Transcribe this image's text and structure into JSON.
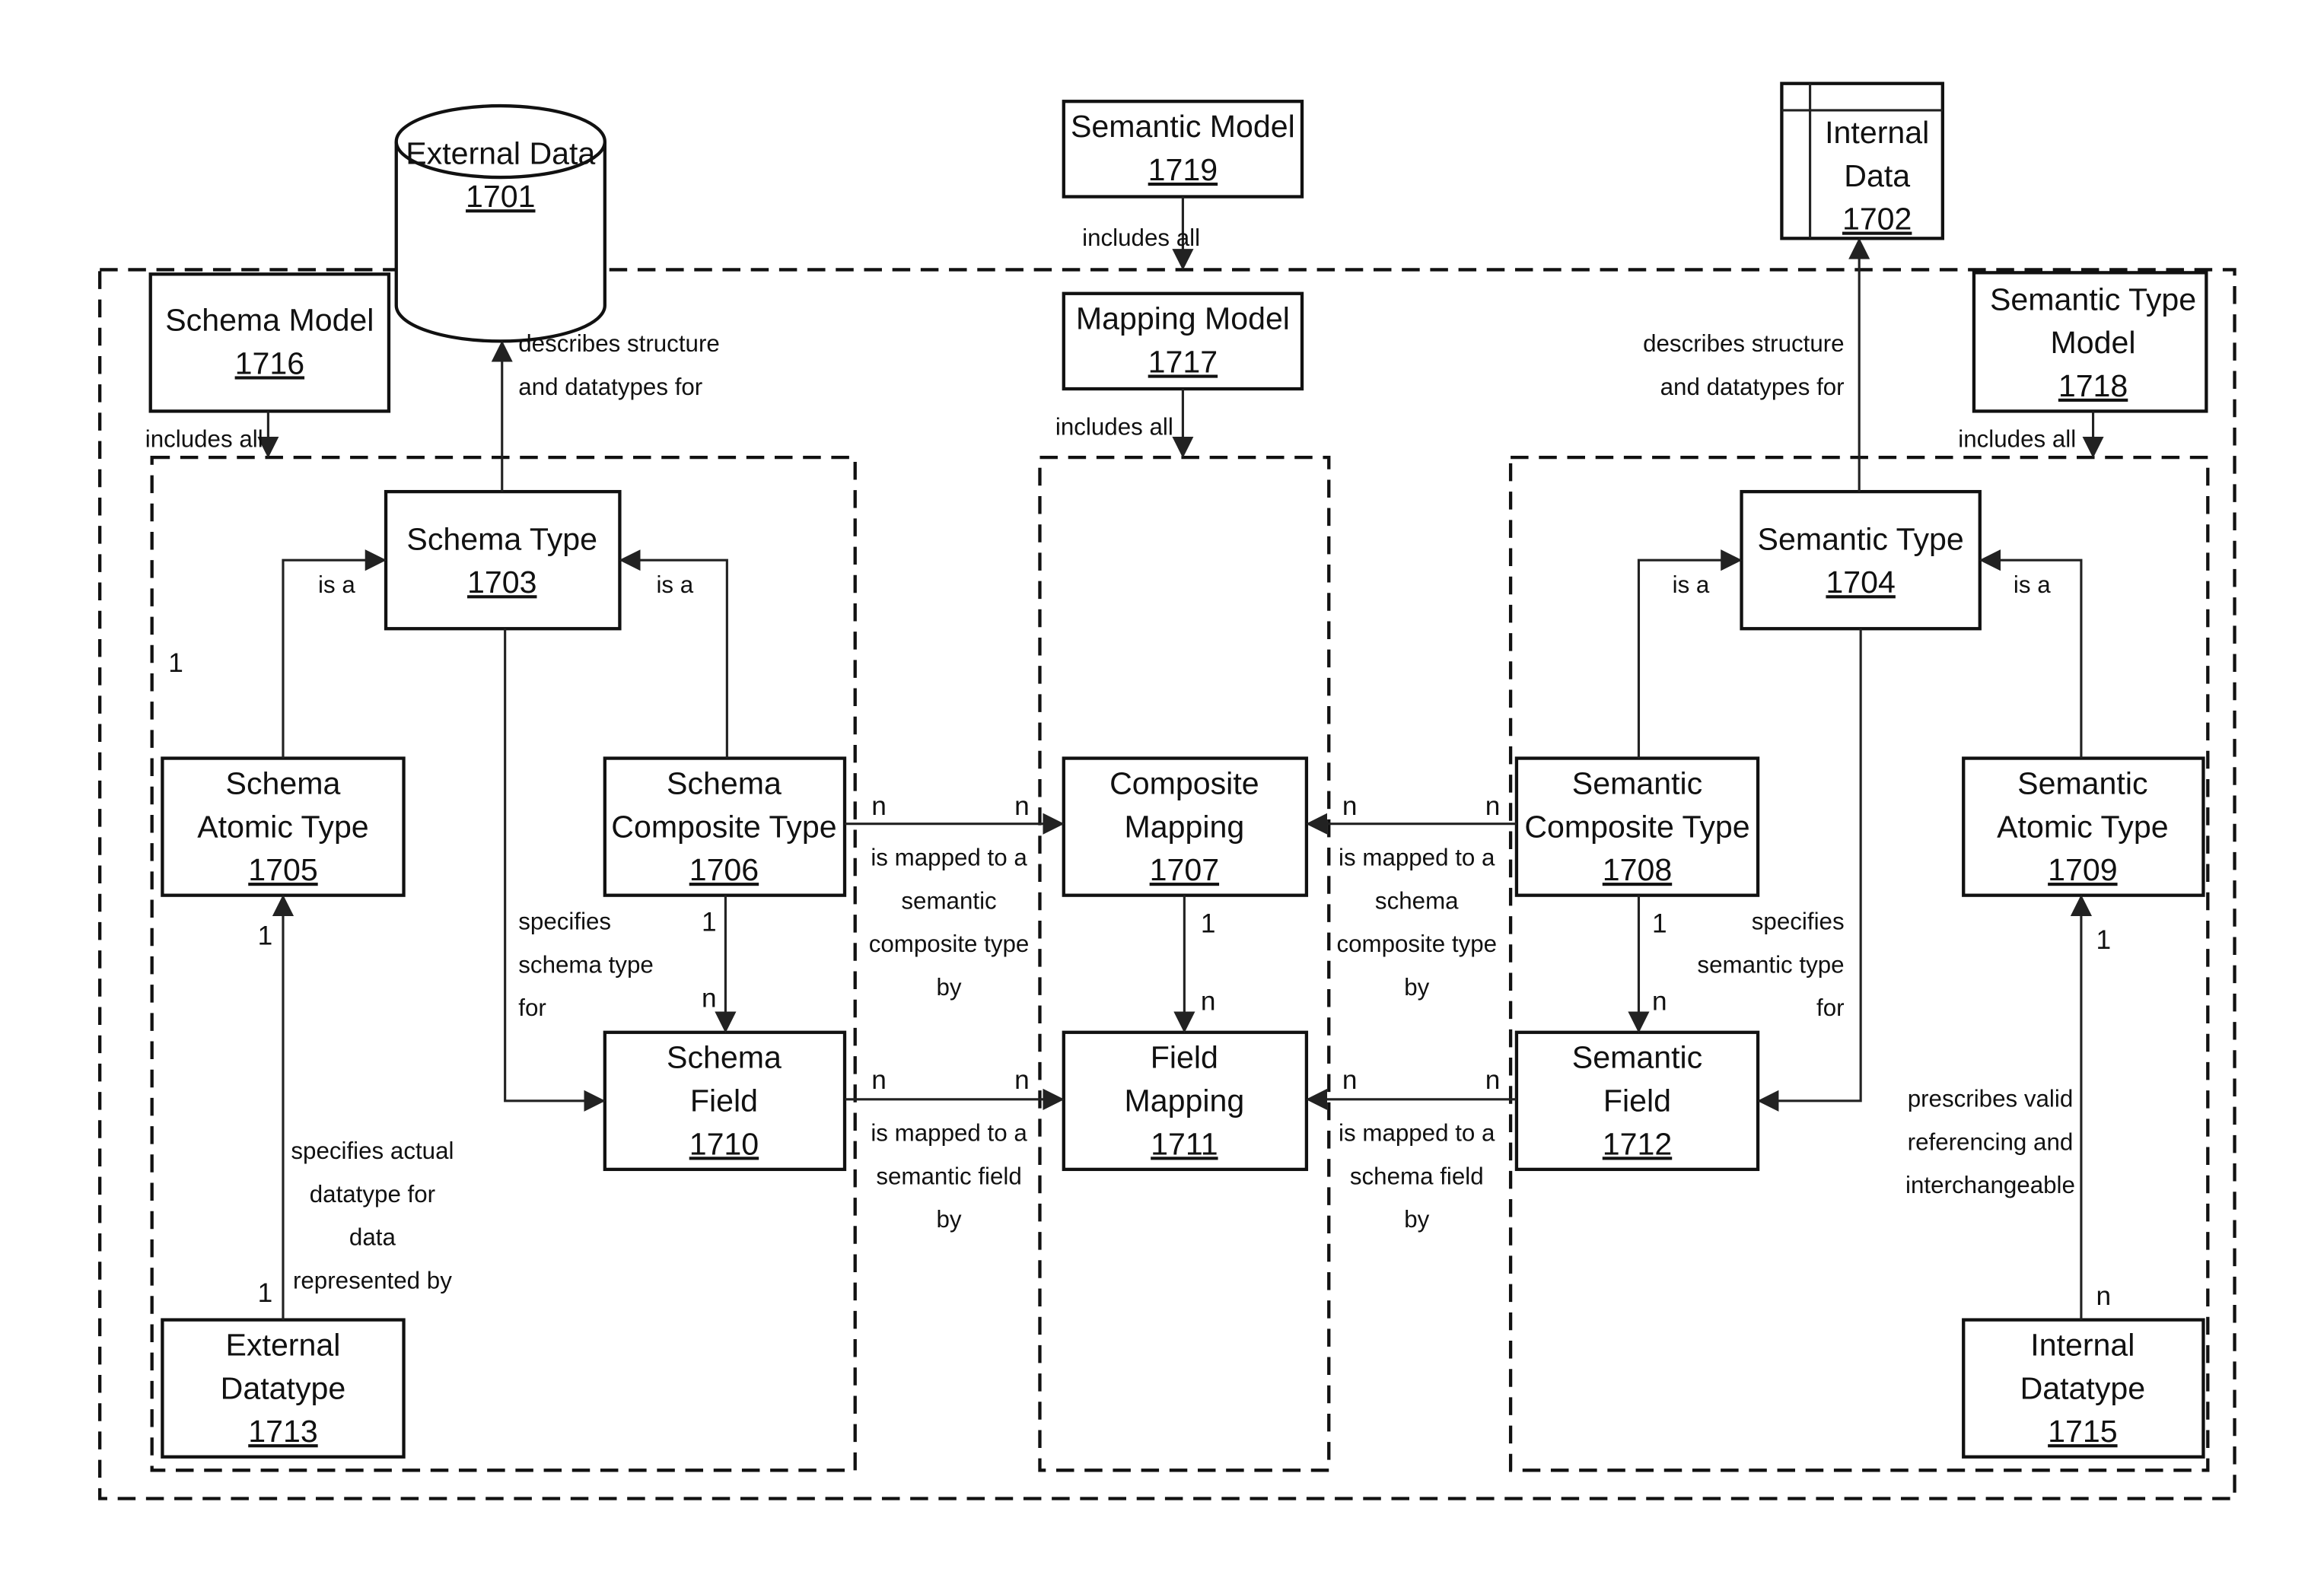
{
  "nodes": {
    "external_data": {
      "lines": [
        "External Data"
      ],
      "num": "1701"
    },
    "internal_data": {
      "lines": [
        "Internal",
        "Data"
      ],
      "num": "1702"
    },
    "schema_type": {
      "lines": [
        "Schema Type"
      ],
      "num": "1703"
    },
    "semantic_type": {
      "lines": [
        "Semantic Type"
      ],
      "num": "1704"
    },
    "schema_atomic_type": {
      "lines": [
        "Schema",
        "Atomic Type"
      ],
      "num": "1705"
    },
    "schema_composite_type": {
      "lines": [
        "Schema",
        "Composite Type"
      ],
      "num": "1706"
    },
    "composite_mapping": {
      "lines": [
        "Composite",
        "Mapping"
      ],
      "num": "1707"
    },
    "semantic_composite_type": {
      "lines": [
        "Semantic",
        "Composite Type"
      ],
      "num": "1708"
    },
    "semantic_atomic_type": {
      "lines": [
        "Semantic",
        "Atomic Type"
      ],
      "num": "1709"
    },
    "schema_field": {
      "lines": [
        "Schema",
        "Field"
      ],
      "num": "1710"
    },
    "field_mapping": {
      "lines": [
        "Field",
        "Mapping"
      ],
      "num": "1711"
    },
    "semantic_field": {
      "lines": [
        "Semantic",
        "Field"
      ],
      "num": "1712"
    },
    "external_datatype": {
      "lines": [
        "External",
        "Datatype"
      ],
      "num": "1713"
    },
    "internal_datatype": {
      "lines": [
        "Internal",
        "Datatype"
      ],
      "num": "1715"
    },
    "schema_model": {
      "lines": [
        "Schema Model"
      ],
      "num": "1716"
    },
    "mapping_model": {
      "lines": [
        "Mapping Model"
      ],
      "num": "1717"
    },
    "semantic_type_model": {
      "lines": [
        "Semantic Type",
        "Model"
      ],
      "num": "1718"
    },
    "semantic_model": {
      "lines": [
        "Semantic Model"
      ],
      "num": "1719"
    }
  },
  "labels": {
    "includes_all": "includes all",
    "is_a": "is a",
    "describes_structure": [
      "describes structure",
      "and datatypes for"
    ],
    "specifies_schema_type": [
      "specifies",
      "schema type",
      "for"
    ],
    "specifies_semantic_type": [
      "specifies",
      "semantic type",
      "for"
    ],
    "specifies_actual_datatype": [
      "specifies actual",
      "datatype for",
      "data",
      "represented by"
    ],
    "prescribes_valid": [
      "prescribes valid",
      "referencing and",
      "interchangeable"
    ],
    "mapped_semantic_composite": [
      "is mapped to a",
      "semantic",
      "composite type",
      "by"
    ],
    "mapped_schema_composite": [
      "is mapped to a",
      "schema",
      "composite type",
      "by"
    ],
    "mapped_semantic_field": [
      "is mapped to a",
      "semantic field",
      "by"
    ],
    "mapped_schema_field": [
      "is mapped to a",
      "schema field",
      "by"
    ]
  },
  "cardinality": {
    "one": "1",
    "many": "n"
  }
}
